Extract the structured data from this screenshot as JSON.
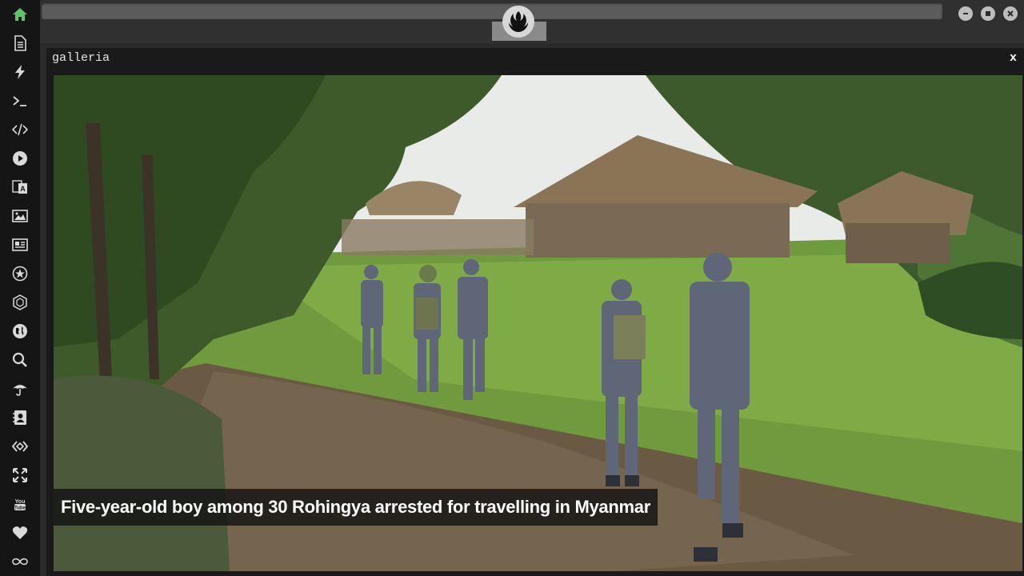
{
  "dock": {
    "items": [
      {
        "name": "home-icon"
      },
      {
        "name": "document-icon"
      },
      {
        "name": "lightning-icon"
      },
      {
        "name": "terminal-icon"
      },
      {
        "name": "code-icon"
      },
      {
        "name": "play-icon"
      },
      {
        "name": "translate-icon"
      },
      {
        "name": "image-icon"
      },
      {
        "name": "newspaper-icon"
      },
      {
        "name": "star-badge-icon"
      },
      {
        "name": "hexagon-icon"
      },
      {
        "name": "globe-icon"
      },
      {
        "name": "search-icon"
      },
      {
        "name": "umbrella-icon"
      },
      {
        "name": "contact-icon"
      },
      {
        "name": "network-icon"
      },
      {
        "name": "fullscreen-icon"
      },
      {
        "name": "youtube-icon"
      },
      {
        "name": "heart-icon"
      },
      {
        "name": "infinity-icon"
      }
    ],
    "active_color": "#5ec46a"
  },
  "window": {
    "title": "galleria",
    "close_label": "x"
  },
  "gallery": {
    "caption": "Five-year-old boy among 30 Rohingya arrested for travelling in Myanmar"
  }
}
